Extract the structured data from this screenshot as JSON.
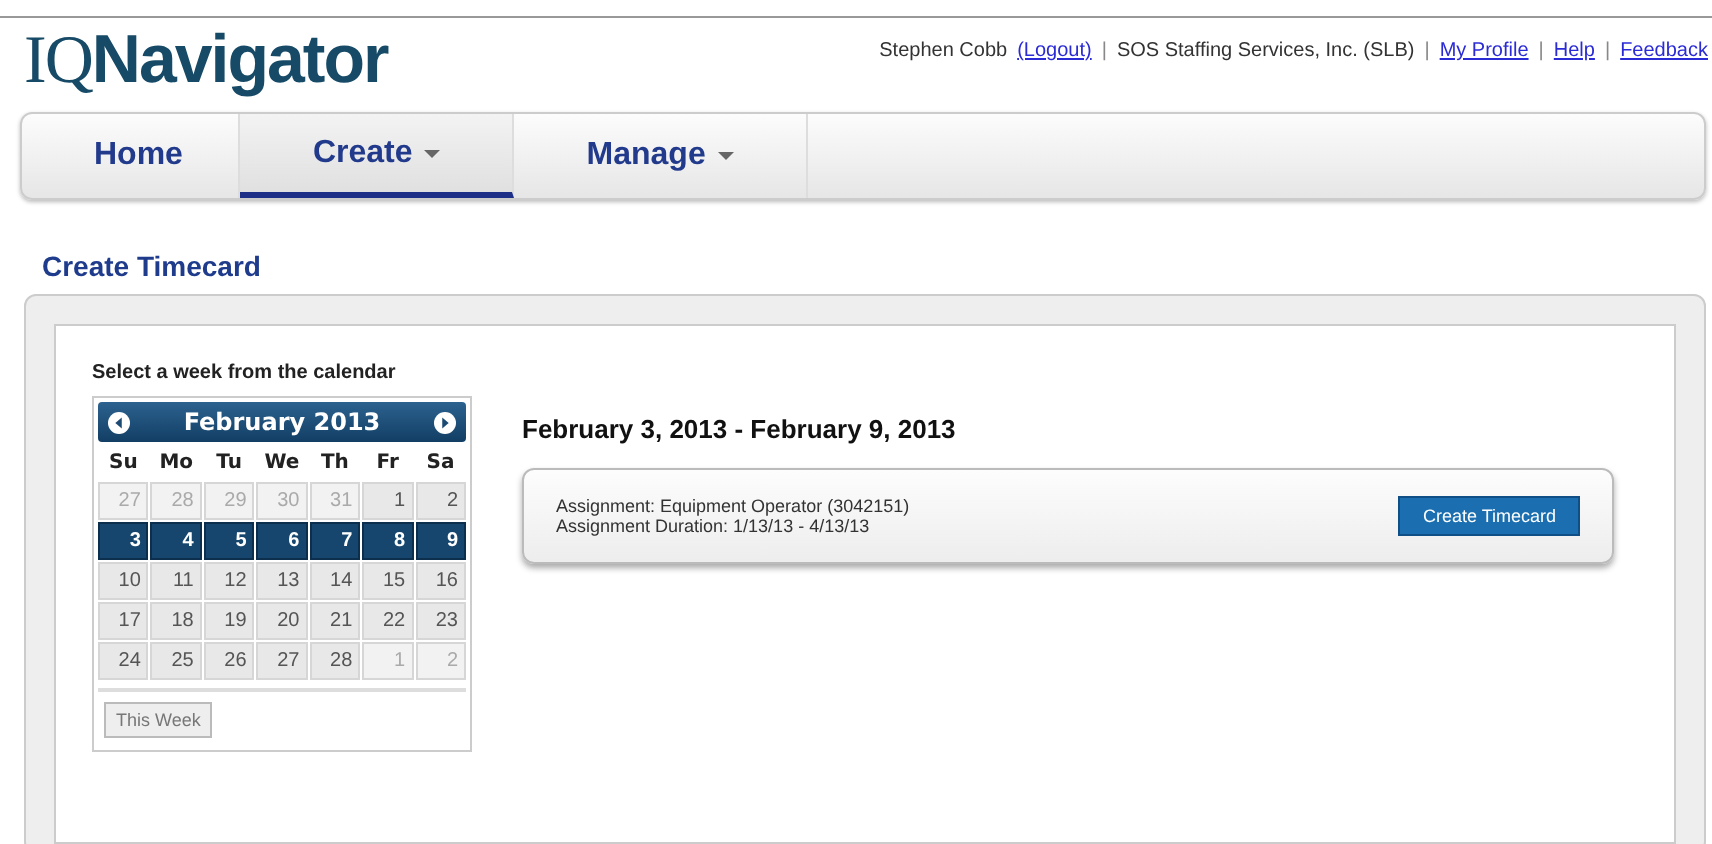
{
  "logo": {
    "prefix": "IQ",
    "name": "Navigator"
  },
  "header_links": [
    {
      "kind": "text",
      "label": "Stephen Cobb"
    },
    {
      "kind": "link",
      "label": "(Logout)"
    },
    {
      "kind": "sep",
      "label": "|"
    },
    {
      "kind": "text",
      "label": "SOS Staffing Services, Inc. (SLB)"
    },
    {
      "kind": "sep",
      "label": "|"
    },
    {
      "kind": "link",
      "label": "My Profile"
    },
    {
      "kind": "sep",
      "label": "|"
    },
    {
      "kind": "link",
      "label": "Help"
    },
    {
      "kind": "sep",
      "label": "|"
    },
    {
      "kind": "link",
      "label": "Feedback"
    }
  ],
  "nav": [
    {
      "label": "Home",
      "dropdown": false,
      "selected": false
    },
    {
      "label": "Create",
      "dropdown": true,
      "selected": true
    },
    {
      "label": "Manage",
      "dropdown": true,
      "selected": false
    }
  ],
  "page_title": "Create Timecard",
  "calendar": {
    "prompt": "Select a week from the calendar",
    "month": "February 2013",
    "weekdays": [
      "Su",
      "Mo",
      "Tu",
      "We",
      "Th",
      "Fr",
      "Sa"
    ],
    "weeks": [
      [
        {
          "d": "27",
          "other_month": true,
          "selected": false
        },
        {
          "d": "28",
          "other_month": true,
          "selected": false
        },
        {
          "d": "29",
          "other_month": true,
          "selected": false
        },
        {
          "d": "30",
          "other_month": true,
          "selected": false
        },
        {
          "d": "31",
          "other_month": true,
          "selected": false
        },
        {
          "d": "1",
          "other_month": false,
          "selected": false
        },
        {
          "d": "2",
          "other_month": false,
          "selected": false
        }
      ],
      [
        {
          "d": "3",
          "other_month": false,
          "selected": true
        },
        {
          "d": "4",
          "other_month": false,
          "selected": true
        },
        {
          "d": "5",
          "other_month": false,
          "selected": true
        },
        {
          "d": "6",
          "other_month": false,
          "selected": true
        },
        {
          "d": "7",
          "other_month": false,
          "selected": true
        },
        {
          "d": "8",
          "other_month": false,
          "selected": true
        },
        {
          "d": "9",
          "other_month": false,
          "selected": true
        }
      ],
      [
        {
          "d": "10",
          "other_month": false,
          "selected": false
        },
        {
          "d": "11",
          "other_month": false,
          "selected": false
        },
        {
          "d": "12",
          "other_month": false,
          "selected": false
        },
        {
          "d": "13",
          "other_month": false,
          "selected": false
        },
        {
          "d": "14",
          "other_month": false,
          "selected": false
        },
        {
          "d": "15",
          "other_month": false,
          "selected": false
        },
        {
          "d": "16",
          "other_month": false,
          "selected": false
        }
      ],
      [
        {
          "d": "17",
          "other_month": false,
          "selected": false
        },
        {
          "d": "18",
          "other_month": false,
          "selected": false
        },
        {
          "d": "19",
          "other_month": false,
          "selected": false
        },
        {
          "d": "20",
          "other_month": false,
          "selected": false
        },
        {
          "d": "21",
          "other_month": false,
          "selected": false
        },
        {
          "d": "22",
          "other_month": false,
          "selected": false
        },
        {
          "d": "23",
          "other_month": false,
          "selected": false
        }
      ],
      [
        {
          "d": "24",
          "other_month": false,
          "selected": false
        },
        {
          "d": "25",
          "other_month": false,
          "selected": false
        },
        {
          "d": "26",
          "other_month": false,
          "selected": false
        },
        {
          "d": "27",
          "other_month": false,
          "selected": false
        },
        {
          "d": "28",
          "other_month": false,
          "selected": false
        },
        {
          "d": "1",
          "other_month": true,
          "selected": false
        },
        {
          "d": "2",
          "other_month": true,
          "selected": false
        }
      ]
    ],
    "this_week_button": "This Week"
  },
  "week_range": "February 3, 2013 - February 9, 2013",
  "assignment": {
    "line1": "Assignment: Equipment Operator (3042151)",
    "line2": "Assignment Duration: 1/13/13 - 4/13/13",
    "button": "Create Timecard"
  }
}
